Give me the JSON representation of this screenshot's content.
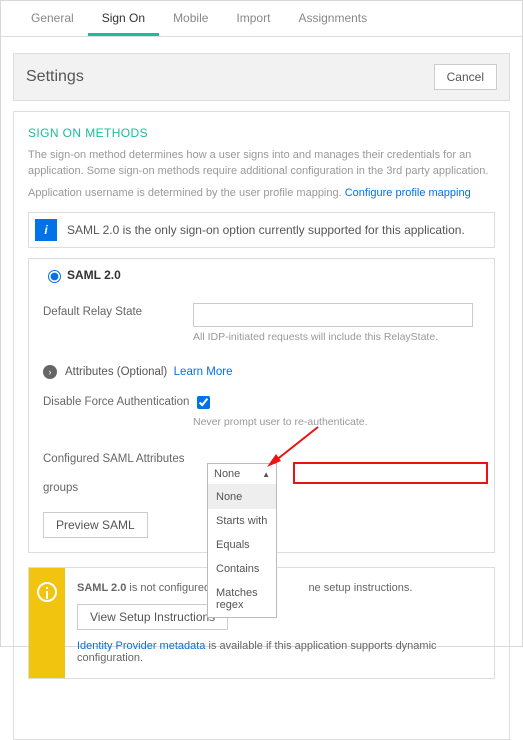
{
  "tabs": {
    "general": "General",
    "signon": "Sign On",
    "mobile": "Mobile",
    "import": "Import",
    "assignments": "Assignments"
  },
  "settings": {
    "title": "Settings",
    "cancel": "Cancel"
  },
  "section": {
    "heading": "SIGN ON METHODS",
    "desc": "The sign-on method determines how a user signs into and manages their credentials for an application. Some sign-on methods require additional configuration in the 3rd party application.",
    "mapping_prefix": "Application username is determined by the user profile mapping. ",
    "mapping_link": "Configure profile mapping"
  },
  "info_banner": "SAML 2.0 is the only sign-on option currently supported for this application.",
  "saml": {
    "radio_label": "SAML 2.0",
    "relay_label": "Default Relay State",
    "relay_hint": "All IDP-initiated requests will include this RelayState.",
    "attributes_label": "Attributes (Optional)",
    "learn_more": "Learn More",
    "disable_auth_label": "Disable Force Authentication",
    "disable_auth_hint": "Never prompt user to re-authenticate.",
    "configured_attrs": "Configured SAML Attributes",
    "groups_label": "groups",
    "preview_btn": "Preview SAML"
  },
  "dropdown": {
    "selected": "None",
    "options": [
      "None",
      "Starts with",
      "Equals",
      "Contains",
      "Matches regex"
    ]
  },
  "warning": {
    "text_prefix": "SAML 2.0",
    "text_mid": " is not configured unt",
    "text_suffix": "ne setup instructions.",
    "setup_btn": "View Setup Instructions",
    "meta_link": "Identity Provider metadata",
    "meta_text": " is available if this application supports dynamic configuration."
  }
}
